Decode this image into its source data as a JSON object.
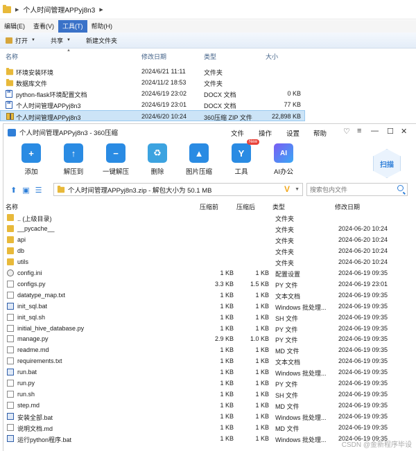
{
  "explorer": {
    "breadcrumb": "个人时间管理APPyj8n3",
    "menu": [
      "编辑(E)",
      "查看(V)",
      "工具(T)",
      "帮助(H)"
    ],
    "toolbar": {
      "open": "打开",
      "share": "共享",
      "new_folder": "新建文件夹"
    },
    "columns": {
      "name": "名称",
      "date": "修改日期",
      "type": "类型",
      "size": "大小"
    },
    "rows": [
      {
        "name": "环境安装环境",
        "date": "2024/6/21 11:11",
        "type": "文件夹",
        "size": ""
      },
      {
        "name": "数据库文件",
        "date": "2024/11/2 18:53",
        "type": "文件夹",
        "size": ""
      },
      {
        "name": "python-flask环境配置文档",
        "date": "2024/6/19 23:02",
        "type": "DOCX 文档",
        "size": "0 KB"
      },
      {
        "name": "个人时间管理APPyj8n3",
        "date": "2024/6/19 23:01",
        "type": "DOCX 文档",
        "size": "77 KB"
      },
      {
        "name": "个人时间管理APPyj8n3",
        "date": "2024/6/20 10:24",
        "type": "360压缩 ZIP 文件",
        "size": "22,898 KB"
      }
    ]
  },
  "zip": {
    "title": "个人时间管理APPyj8n3 - 360压缩",
    "menus": [
      "文件",
      "操作",
      "设置",
      "帮助"
    ],
    "tools": [
      {
        "label": "添加",
        "icon": "add-icon"
      },
      {
        "label": "解压到",
        "icon": "extract-to-icon"
      },
      {
        "label": "一键解压",
        "icon": "one-click-extract-icon"
      },
      {
        "label": "删除",
        "icon": "delete-icon"
      },
      {
        "label": "图片压缩",
        "icon": "image-compress-icon"
      },
      {
        "label": "工具",
        "icon": "tools-icon"
      },
      {
        "label": "AI办公",
        "icon": "ai-office-icon"
      }
    ],
    "new_badge": "New",
    "ai_text": "AI",
    "scan": "扫描",
    "path": "个人时间管理APPyj8n3.zip - 解包大小为 50.1 MB",
    "search_placeholder": "搜索包内文件",
    "columns": {
      "name": "名称",
      "csize": "压缩前",
      "asize": "压缩后",
      "type": "类型",
      "date": "修改日期"
    },
    "rows": [
      {
        "icon": "folder",
        "name": ".. (上级目录)",
        "c": "",
        "a": "",
        "type": "文件夹",
        "date": ""
      },
      {
        "icon": "folder",
        "name": "__pycache__",
        "c": "",
        "a": "",
        "type": "文件夹",
        "date": "2024-06-20 10:24"
      },
      {
        "icon": "folder",
        "name": "api",
        "c": "",
        "a": "",
        "type": "文件夹",
        "date": "2024-06-20 10:24"
      },
      {
        "icon": "folder",
        "name": "db",
        "c": "",
        "a": "",
        "type": "文件夹",
        "date": "2024-06-20 10:24"
      },
      {
        "icon": "folder",
        "name": "utils",
        "c": "",
        "a": "",
        "type": "文件夹",
        "date": "2024-06-20 10:24"
      },
      {
        "icon": "gear",
        "name": "config.ini",
        "c": "1 KB",
        "a": "1 KB",
        "type": "配置设置",
        "date": "2024-06-19 09:35"
      },
      {
        "icon": "file",
        "name": "configs.py",
        "c": "3.3 KB",
        "a": "1.5 KB",
        "type": "PY 文件",
        "date": "2024-06-19 23:01"
      },
      {
        "icon": "file",
        "name": "datatype_map.txt",
        "c": "1 KB",
        "a": "1 KB",
        "type": "文本文档",
        "date": "2024-06-19 09:35"
      },
      {
        "icon": "bat",
        "name": "init_sql.bat",
        "c": "1 KB",
        "a": "1 KB",
        "type": "Windows 批处理...",
        "date": "2024-06-19 09:35"
      },
      {
        "icon": "file",
        "name": "init_sql.sh",
        "c": "1 KB",
        "a": "1 KB",
        "type": "SH 文件",
        "date": "2024-06-19 09:35"
      },
      {
        "icon": "file",
        "name": "initial_hive_database.py",
        "c": "1 KB",
        "a": "1 KB",
        "type": "PY 文件",
        "date": "2024-06-19 09:35"
      },
      {
        "icon": "file",
        "name": "manage.py",
        "c": "2.9 KB",
        "a": "1.0 KB",
        "type": "PY 文件",
        "date": "2024-06-19 09:35"
      },
      {
        "icon": "file",
        "name": "readme.md",
        "c": "1 KB",
        "a": "1 KB",
        "type": "MD 文件",
        "date": "2024-06-19 09:35"
      },
      {
        "icon": "file",
        "name": "requirements.txt",
        "c": "1 KB",
        "a": "1 KB",
        "type": "文本文档",
        "date": "2024-06-19 09:35"
      },
      {
        "icon": "bat",
        "name": "run.bat",
        "c": "1 KB",
        "a": "1 KB",
        "type": "Windows 批处理...",
        "date": "2024-06-19 09:35"
      },
      {
        "icon": "file",
        "name": "run.py",
        "c": "1 KB",
        "a": "1 KB",
        "type": "PY 文件",
        "date": "2024-06-19 09:35"
      },
      {
        "icon": "file",
        "name": "run.sh",
        "c": "1 KB",
        "a": "1 KB",
        "type": "SH 文件",
        "date": "2024-06-19 09:35"
      },
      {
        "icon": "file",
        "name": "step.md",
        "c": "1 KB",
        "a": "1 KB",
        "type": "MD 文件",
        "date": "2024-06-19 09:35"
      },
      {
        "icon": "bat",
        "name": "安装全部.bat",
        "c": "1 KB",
        "a": "1 KB",
        "type": "Windows 批处理...",
        "date": "2024-06-19 09:35"
      },
      {
        "icon": "file",
        "name": "说明文档.md",
        "c": "1 KB",
        "a": "1 KB",
        "type": "MD 文件",
        "date": "2024-06-19 09:35"
      },
      {
        "icon": "bat",
        "name": "运行python程序.bat",
        "c": "1 KB",
        "a": "1 KB",
        "type": "Windows 批处理...",
        "date": "2024-06-19 09:35"
      }
    ]
  },
  "watermark": "CSDN @金新程序毕设"
}
